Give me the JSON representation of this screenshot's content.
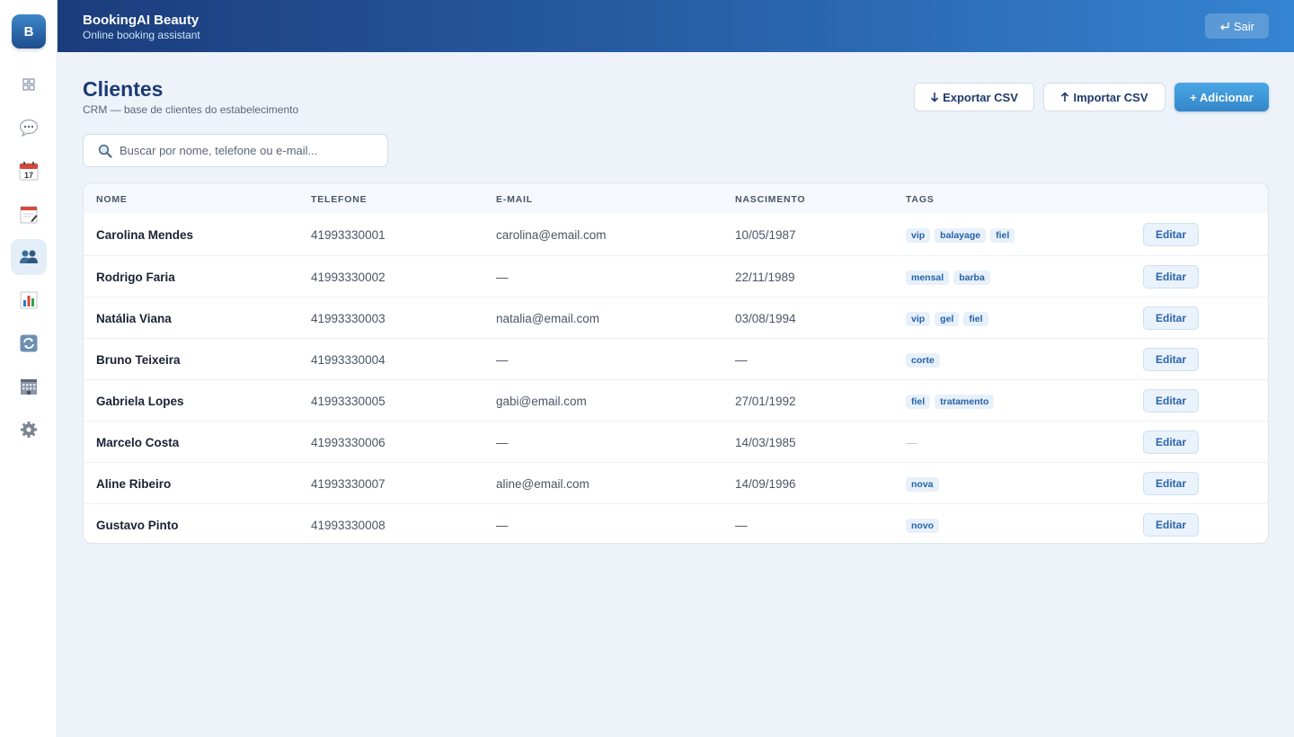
{
  "app": {
    "logo_letter": "B",
    "title": "BookingAI Beauty",
    "subtitle": "Online booking assistant",
    "logout_label": "Sair"
  },
  "sidebar": {
    "items": [
      {
        "icon": "dashboard-icon",
        "active": false
      },
      {
        "icon": "chat-icon",
        "active": false
      },
      {
        "icon": "calendar-icon",
        "active": false
      },
      {
        "icon": "notepad-icon",
        "active": false
      },
      {
        "icon": "clients-icon",
        "active": true
      },
      {
        "icon": "chart-icon",
        "active": false
      },
      {
        "icon": "sync-icon",
        "active": false
      },
      {
        "icon": "building-icon",
        "active": false
      },
      {
        "icon": "settings-icon",
        "active": false
      }
    ]
  },
  "page": {
    "title": "Clientes",
    "subtitle": "CRM — base de clientes do estabelecimento"
  },
  "actions": {
    "export_label": "Exportar CSV",
    "import_label": "Importar CSV",
    "add_label": "+ Adicionar"
  },
  "search": {
    "placeholder": "Buscar por nome, telefone ou e-mail...",
    "value": ""
  },
  "table": {
    "columns": [
      "NOME",
      "TELEFONE",
      "E-MAIL",
      "NASCIMENTO",
      "TAGS"
    ],
    "edit_label": "Editar",
    "empty_tags": "—",
    "rows": [
      {
        "name": "Carolina Mendes",
        "phone": "41993330001",
        "email": "carolina@email.com",
        "birth": "10/05/1987",
        "tags": [
          "vip",
          "balayage",
          "fiel"
        ]
      },
      {
        "name": "Rodrigo Faria",
        "phone": "41993330002",
        "email": "—",
        "birth": "22/11/1989",
        "tags": [
          "mensal",
          "barba"
        ]
      },
      {
        "name": "Natália Viana",
        "phone": "41993330003",
        "email": "natalia@email.com",
        "birth": "03/08/1994",
        "tags": [
          "vip",
          "gel",
          "fiel"
        ]
      },
      {
        "name": "Bruno Teixeira",
        "phone": "41993330004",
        "email": "—",
        "birth": "—",
        "tags": [
          "corte"
        ]
      },
      {
        "name": "Gabriela Lopes",
        "phone": "41993330005",
        "email": "gabi@email.com",
        "birth": "27/01/1992",
        "tags": [
          "fiel",
          "tratamento"
        ]
      },
      {
        "name": "Marcelo Costa",
        "phone": "41993330006",
        "email": "—",
        "birth": "14/03/1985",
        "tags": []
      },
      {
        "name": "Aline Ribeiro",
        "phone": "41993330007",
        "email": "aline@email.com",
        "birth": "14/09/1996",
        "tags": [
          "nova"
        ]
      },
      {
        "name": "Gustavo Pinto",
        "phone": "41993330008",
        "email": "—",
        "birth": "—",
        "tags": [
          "novo"
        ]
      }
    ]
  }
}
